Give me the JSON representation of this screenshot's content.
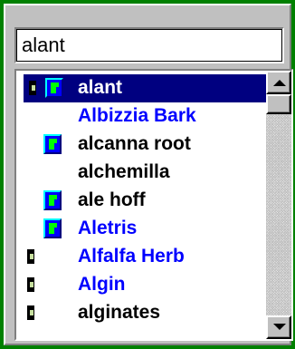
{
  "search": {
    "value": "alant"
  },
  "list": {
    "items": [
      {
        "label": "alant",
        "color": "selected",
        "doc_icon": true,
        "flag_icon": true,
        "selected": true
      },
      {
        "label": "Albizzia Bark",
        "color": "blue",
        "doc_icon": false,
        "flag_icon": false
      },
      {
        "label": "alcanna root",
        "color": "black",
        "doc_icon": false,
        "flag_icon": true
      },
      {
        "label": "alchemilla",
        "color": "black",
        "doc_icon": false,
        "flag_icon": false
      },
      {
        "label": "ale hoff",
        "color": "black",
        "doc_icon": false,
        "flag_icon": true
      },
      {
        "label": "Aletris",
        "color": "blue",
        "doc_icon": false,
        "flag_icon": true
      },
      {
        "label": "Alfalfa Herb",
        "color": "blue",
        "doc_icon": true,
        "flag_icon": false
      },
      {
        "label": "Algin",
        "color": "blue",
        "doc_icon": true,
        "flag_icon": false
      },
      {
        "label": "alginates",
        "color": "black",
        "doc_icon": true,
        "flag_icon": false
      }
    ]
  },
  "colors": {
    "background": "#008000",
    "selection": "#000080",
    "link_blue": "#0000ff"
  }
}
